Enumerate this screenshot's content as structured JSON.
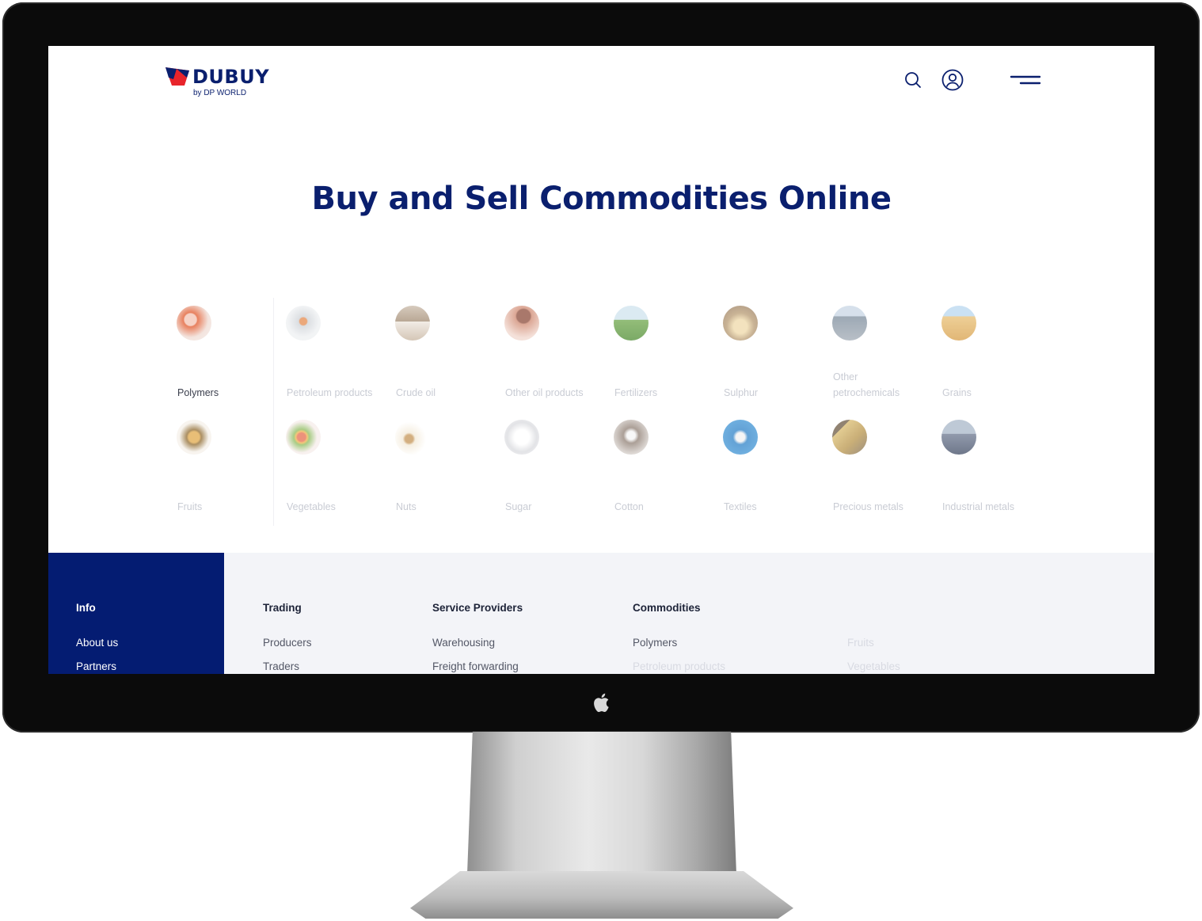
{
  "logo": {
    "name": "DUBUY",
    "tagline": "by DP WORLD"
  },
  "header_icons": [
    "search-icon",
    "user-account-icon",
    "menu-icon"
  ],
  "hero": {
    "title": "Buy and Sell Commodities Online"
  },
  "commodities": [
    {
      "label": "Polymers",
      "active": true
    },
    {
      "label": "Petroleum products"
    },
    {
      "label": "Crude oil"
    },
    {
      "label": "Other oil products"
    },
    {
      "label": "Fertilizers"
    },
    {
      "label": "Sulphur"
    },
    {
      "label": "Other petrochemicals"
    },
    {
      "label": "Grains"
    },
    {
      "label": "Fruits"
    },
    {
      "label": "Vegetables"
    },
    {
      "label": "Nuts"
    },
    {
      "label": "Sugar"
    },
    {
      "label": "Cotton"
    },
    {
      "label": "Textiles"
    },
    {
      "label": "Precious metals"
    },
    {
      "label": "Industrial metals"
    }
  ],
  "footer": {
    "info": {
      "heading": "Info",
      "links": [
        "About us",
        "Partners"
      ]
    },
    "trading": {
      "heading": "Trading",
      "links": [
        "Producers",
        "Traders"
      ]
    },
    "service_providers": {
      "heading": "Service Providers",
      "links": [
        "Warehousing",
        "Freight forwarding"
      ]
    },
    "commodities": {
      "heading": "Commodities",
      "links": [
        "Polymers",
        "Petroleum products"
      ],
      "links_2": [
        "Fruits",
        "Vegetables"
      ]
    }
  },
  "colors": {
    "brand_navy": "#0a1f6e",
    "brand_red": "#e8242b",
    "footer_info_bg": "#041c72",
    "footer_bg": "#f3f4f8"
  }
}
